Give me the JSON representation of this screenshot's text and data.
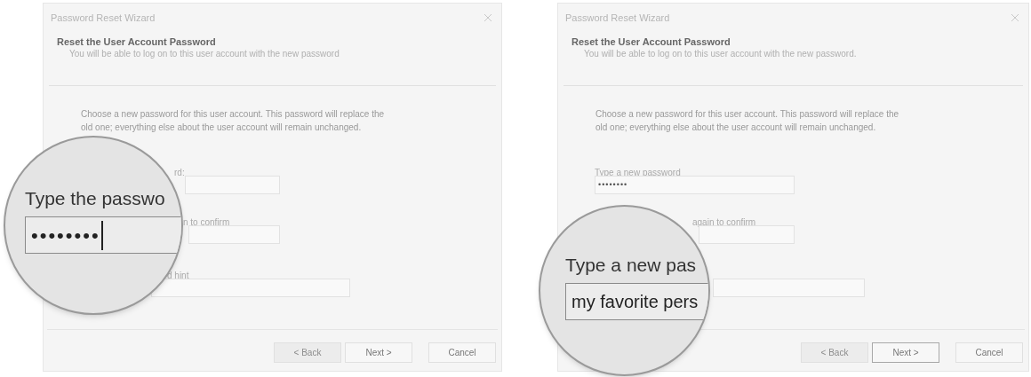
{
  "panels": [
    {
      "window": {
        "title": "Password Reset Wizard"
      },
      "heading": "Reset the User Account Password",
      "subtitle": "You will be able to log on to this user account with the new password",
      "description": "Choose a new password for this user account. This password will replace the old one; everything else about the user account will remain unchanged.",
      "fields": [
        {
          "kind": "password",
          "label": "rd:"
        },
        {
          "kind": "confirm",
          "label": "n to confirm"
        },
        {
          "kind": "hint",
          "label": "d hint"
        }
      ],
      "buttons": [
        {
          "label": "< Back",
          "disabled": true,
          "default": false
        },
        {
          "label": "Next >",
          "disabled": false,
          "default": false
        },
        {
          "label": "Cancel",
          "disabled": false,
          "default": false
        }
      ],
      "magnifier": {
        "label": "Type the passwo",
        "value": "••••••••",
        "caret": true
      }
    },
    {
      "window": {
        "title": "Password Reset Wizard"
      },
      "heading": "Reset the User Account Password",
      "subtitle": "You will be able to log on to this user account with the new password.",
      "description": "Choose a new password for this user account. This password will replace the old one; everything else about the user account will remain unchanged.",
      "fields": [
        {
          "kind": "password",
          "label": "Type a new password",
          "value": "••••••••"
        },
        {
          "kind": "confirm",
          "label": "again to confirm"
        },
        {
          "kind": "hint"
        }
      ],
      "buttons": [
        {
          "label": "< Back",
          "disabled": true,
          "default": false
        },
        {
          "label": "Next >",
          "disabled": false,
          "default": true
        },
        {
          "label": "Cancel",
          "disabled": false,
          "default": false
        }
      ],
      "magnifier": {
        "label": "Type a new pas",
        "value": "my favorite pers",
        "caret": false
      }
    }
  ]
}
